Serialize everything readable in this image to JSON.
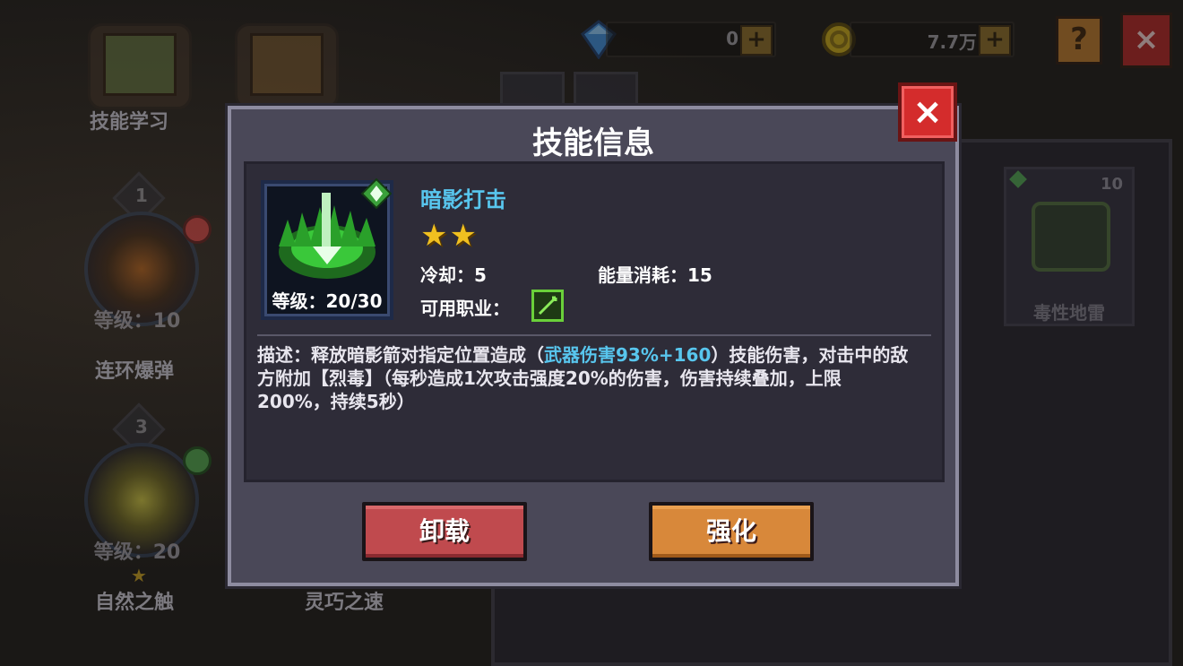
{
  "top_bar": {
    "gems": {
      "value": "0",
      "plus": "+"
    },
    "coins": {
      "value": "7.7万",
      "plus": "+"
    },
    "help_label": "?",
    "close_label": "×"
  },
  "background": {
    "skill_study_label": "技能学习",
    "nodes": [
      {
        "rank": "1",
        "level": "等级：10",
        "name": "连环爆弹"
      },
      {
        "rank": "3",
        "level": "等级：20",
        "name": "自然之触"
      }
    ],
    "agility_label": "灵巧之速",
    "mine_card": {
      "count": "10",
      "name": "毒性地雷"
    }
  },
  "dialog": {
    "title": "技能信息",
    "close_label": "×",
    "skill": {
      "name": "暗影打击",
      "stars": 2,
      "level": "等级：20/30",
      "cooldown": "冷却：5",
      "energy": "能量消耗：15",
      "job_label": "可用职业："
    },
    "description": {
      "prefix": "描述：释放暗影箭对指定位置造成（",
      "highlight": "武器伤害93%+160",
      "suffix": "）技能伤害，对击中的敌方附加【烈毒】（每秒造成1次攻击强度20%的伤害，伤害持续叠加，上限200%，持续5秒）"
    },
    "buttons": {
      "unload": "卸载",
      "upgrade": "强化"
    }
  },
  "colors": {
    "skill_name": "#58c6ee",
    "highlight": "#58c6ee",
    "unload_button": "#c04a4e",
    "upgrade_button": "#d8883a",
    "close_button": "#d42c2c",
    "star": "#f0c020"
  }
}
